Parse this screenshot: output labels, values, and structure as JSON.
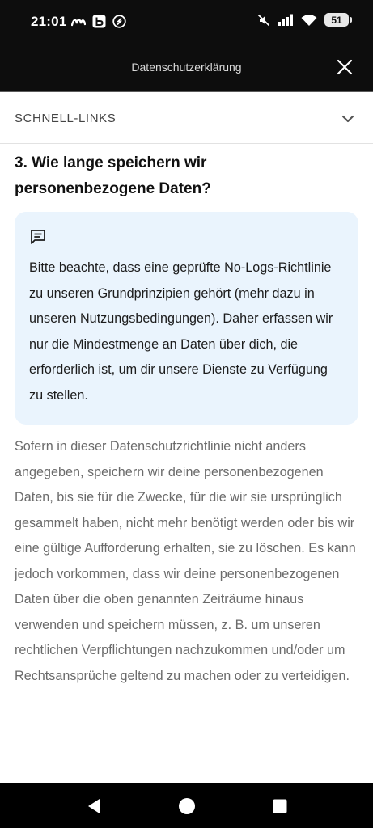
{
  "status_bar": {
    "time": "21:01",
    "battery": "51",
    "left_icons": [
      "am-icon",
      "b-app-icon",
      "shazam-icon"
    ],
    "right_icons": [
      "mute-icon",
      "signal-icon",
      "wifi-icon"
    ]
  },
  "header": {
    "title": "Datenschutzerklärung"
  },
  "quicklinks": {
    "label": "SCHNELL-LINKS"
  },
  "section": {
    "heading": "3. Wie lange speichern wir personenbezogene Daten?"
  },
  "info_box": {
    "icon": "comment-icon",
    "text": "Bitte beachte, dass eine geprüfte No-Logs-Richtlinie zu unseren Grundprinzipien gehört (mehr dazu in unseren Nutzungsbedingungen). Daher erfassen wir nur die Mindestmenge an Daten über dich, die erforderlich ist, um dir unsere Dienste zu Verfügung zu stellen."
  },
  "body": {
    "text": "Sofern in dieser Datenschutzrichtlinie nicht anders angegeben, speichern wir deine personenbezogenen Daten, bis sie für die Zwecke, für die wir sie ursprünglich gesammelt haben, nicht mehr benötigt werden oder bis wir eine gültige Aufforderung erhalten, sie zu löschen. Es kann jedoch vorkommen, dass wir deine personenbezogenen Daten über die oben genannten Zeiträume hinaus verwenden und speichern müssen, z. B. um unseren rechtlichen Verpflichtungen nachzukommen und/oder um Rechtsansprüche geltend zu machen oder zu verteidigen."
  },
  "colors": {
    "bar_background": "#0d0d0d",
    "info_box_background": "#eaf4fd",
    "body_text": "#6b6b6b"
  }
}
